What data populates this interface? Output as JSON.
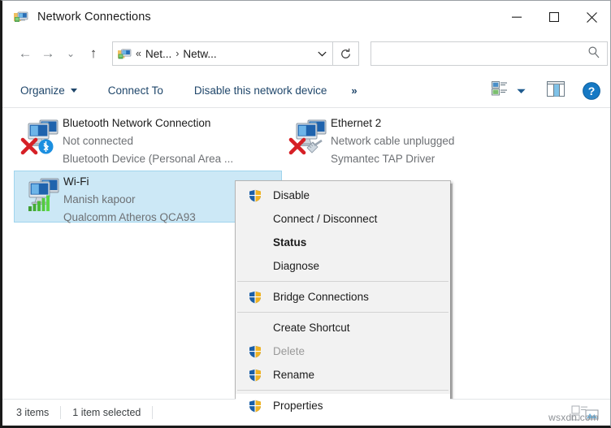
{
  "window": {
    "title": "Network Connections",
    "title_icon": "network-connections-icon",
    "controls": {
      "minimize": "─",
      "maximize": "☐",
      "close": "✕"
    }
  },
  "navbar": {
    "back": "←",
    "forward": "→",
    "recent": "⌄",
    "up": "↑",
    "breadcrumb": {
      "icon": "network-folder-icon",
      "prefix": "«",
      "segments": [
        "Net...",
        "Netw..."
      ],
      "separator": "›",
      "dropdown": "⌄"
    },
    "refresh": "↻"
  },
  "search": {
    "value": "",
    "placeholder": "",
    "icon": "search-icon"
  },
  "commandbar": {
    "items": [
      {
        "label": "Organize",
        "has_caret": true
      },
      {
        "label": "Connect To",
        "has_caret": false
      },
      {
        "label": "Disable this network device",
        "has_caret": false
      }
    ],
    "overflow": "»",
    "view_icon": "change-view-icon",
    "view_caret": "▾",
    "preview_icon": "preview-pane-icon",
    "help_icon": "help-icon",
    "help_glyph": "?"
  },
  "connections": [
    {
      "name": "Bluetooth Network Connection",
      "status": "Not connected",
      "device": "Bluetooth Device (Personal Area ...",
      "icon": "network-adapter-icon",
      "overlay": "bluetooth-icon",
      "error": true,
      "selected": false
    },
    {
      "name": "Ethernet 2",
      "status": "Network cable unplugged",
      "device": "Symantec TAP Driver",
      "icon": "network-adapter-icon",
      "overlay": "ethernet-cable-icon",
      "error": true,
      "selected": false
    },
    {
      "name": "Wi-Fi",
      "status": "Manish kapoor",
      "device": "Qualcomm Atheros QCA93",
      "icon": "network-adapter-icon",
      "overlay": "wifi-signal-icon",
      "error": false,
      "selected": true
    }
  ],
  "context_menu": [
    {
      "label": "Disable",
      "shield": true,
      "bold": false,
      "disabled": false,
      "separator_after": false
    },
    {
      "label": "Connect / Disconnect",
      "shield": false,
      "bold": false,
      "disabled": false,
      "separator_after": false
    },
    {
      "label": "Status",
      "shield": false,
      "bold": true,
      "disabled": false,
      "separator_after": false
    },
    {
      "label": "Diagnose",
      "shield": false,
      "bold": false,
      "disabled": false,
      "separator_after": true
    },
    {
      "label": "Bridge Connections",
      "shield": true,
      "bold": false,
      "disabled": false,
      "separator_after": true
    },
    {
      "label": "Create Shortcut",
      "shield": false,
      "bold": false,
      "disabled": false,
      "separator_after": false
    },
    {
      "label": "Delete",
      "shield": true,
      "bold": false,
      "disabled": true,
      "separator_after": false
    },
    {
      "label": "Rename",
      "shield": true,
      "bold": false,
      "disabled": false,
      "separator_after": true
    }
  ],
  "context_menu_highlighted": {
    "label": "Properties",
    "shield": true
  },
  "statusbar": {
    "item_count": "3 items",
    "selection": "1 item selected"
  },
  "watermark": {
    "text": "wsxdn.com"
  },
  "colors": {
    "selection_blue": "#cce8f6",
    "highlight_red": "#e8212a",
    "link_blue": "#20476b",
    "menu_bg": "#f2f2f2"
  }
}
